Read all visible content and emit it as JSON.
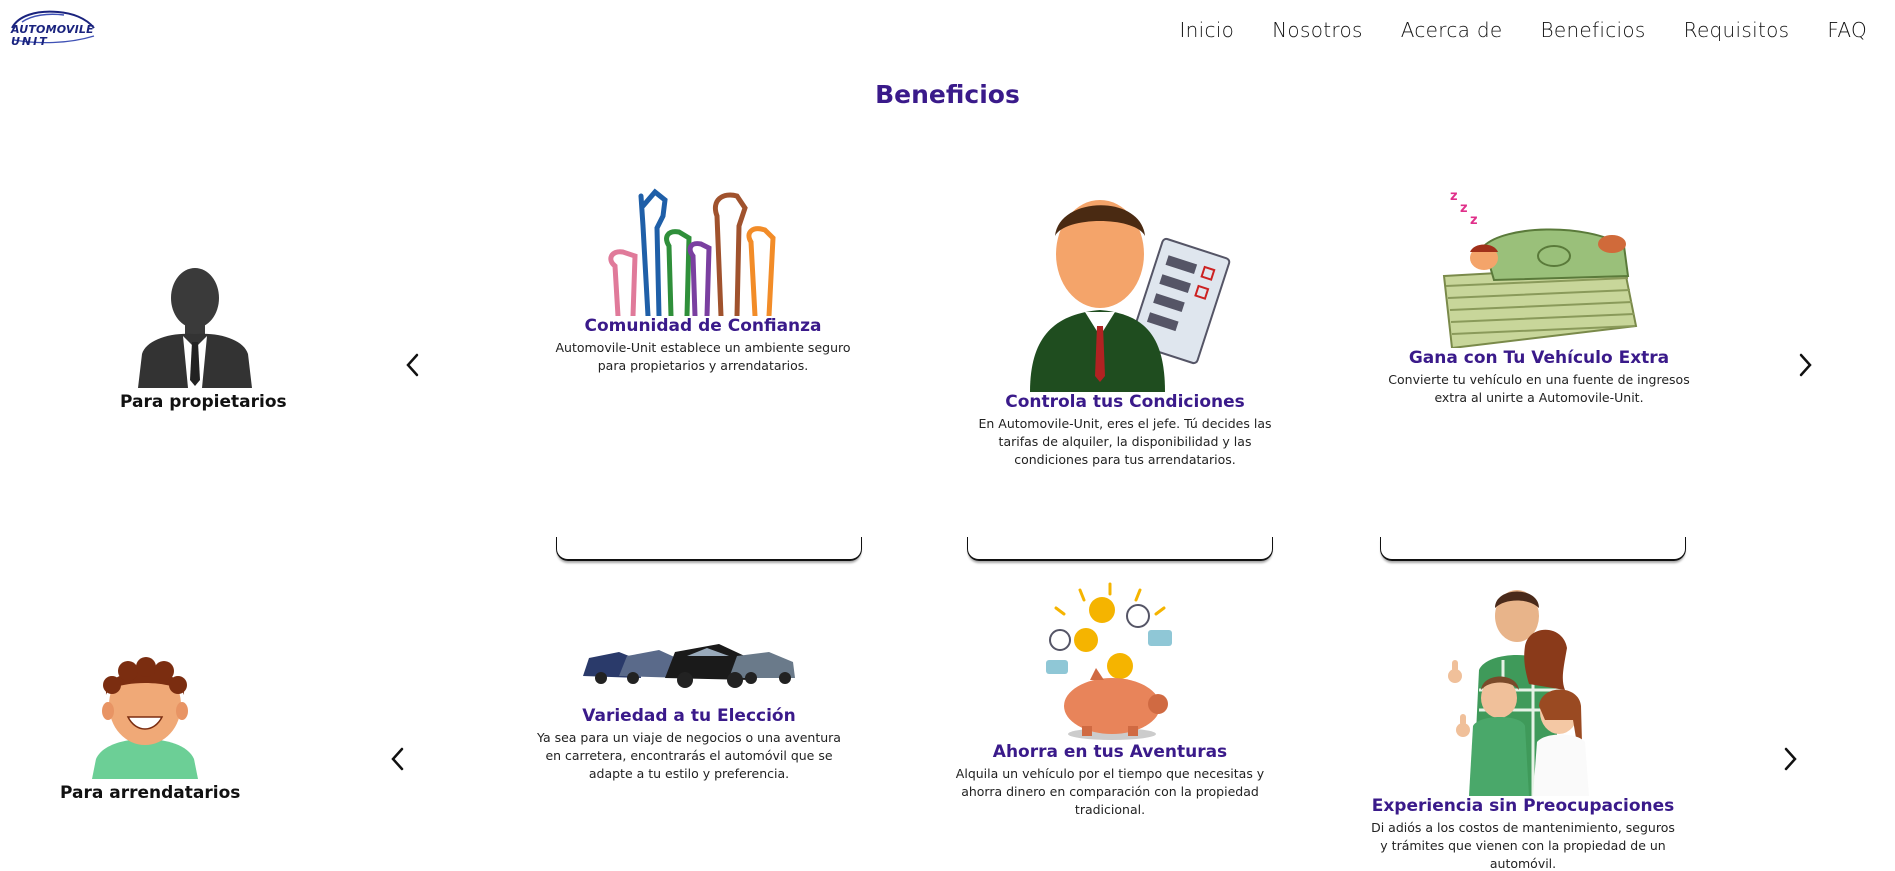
{
  "header": {
    "logo_line1": "AUTOMOVILE",
    "logo_line2": "UNIT",
    "nav": [
      "Inicio",
      "Nosotros",
      "Acerca de",
      "Beneficios",
      "Requisitos",
      "FAQ"
    ]
  },
  "section_title": "Beneficios",
  "owners": {
    "label": "Para propietarios",
    "cards": [
      {
        "title": "Comunidad de Confianza",
        "text": "Automovile-Unit establece un ambiente seguro para propietarios y arrendatarios.",
        "icon": "raised-fists-illustration"
      },
      {
        "title": "Controla tus Condiciones",
        "text": "En Automovile-Unit, eres el jefe. Tú decides las tarifas de alquiler, la disponibilidad y las condiciones para tus arrendatarios.",
        "icon": "businessman-checklist-illustration"
      },
      {
        "title": "Gana con Tu Vehículo Extra",
        "text": "Convierte tu vehículo en una fuente de ingresos extra al unirte a Automovile-Unit.",
        "icon": "sleeping-on-money-illustration"
      }
    ]
  },
  "renters": {
    "label": "Para arrendatarios",
    "cards": [
      {
        "title": "Variedad a tu Elección",
        "text": "Ya sea para un viaje de negocios o una aventura en carretera, encontrarás el automóvil que se adapte a tu estilo y preferencia.",
        "icon": "car-lineup-illustration"
      },
      {
        "title": "Ahorra en tus Aventuras",
        "text": "Alquila un vehículo por el tiempo que necesitas y ahorra dinero en comparación con la propiedad tradicional.",
        "icon": "piggy-bank-coins-illustration"
      },
      {
        "title": "Experiencia sin Preocupaciones",
        "text": "Di adiós a los costos de mantenimiento, seguros y trámites que vienen con la propiedad de un automóvil.",
        "icon": "happy-family-illustration"
      }
    ]
  },
  "colors": {
    "accent": "#3a1a8a",
    "text": "#111111"
  }
}
